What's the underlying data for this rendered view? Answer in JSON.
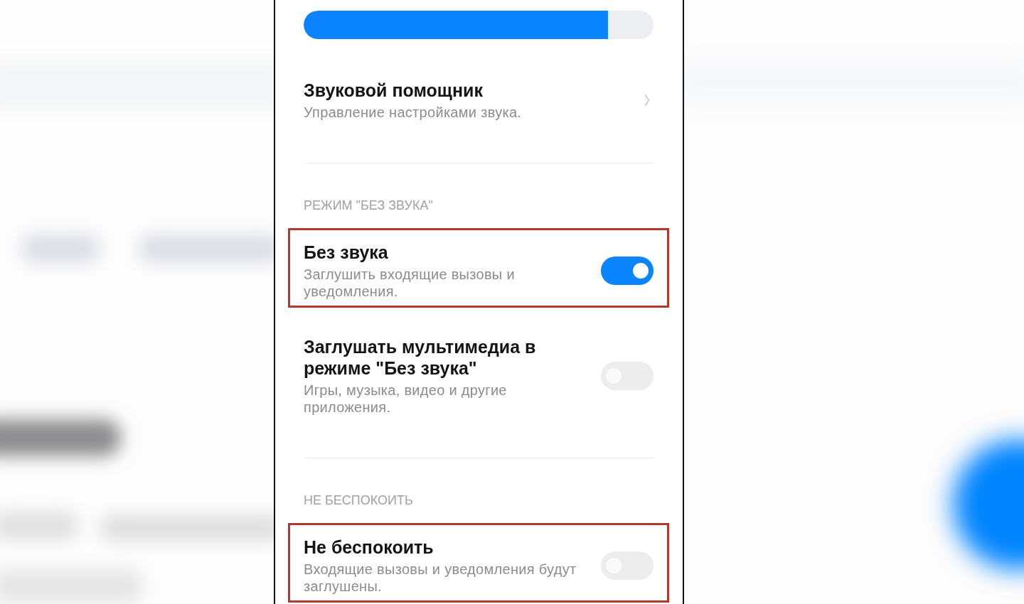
{
  "volume_slider": {
    "level": 0.87
  },
  "sections": [
    {
      "items": [
        {
          "kind": "link",
          "title": "Звуковой помощник",
          "subtitle": "Управление настройками звука.",
          "highlighted": false
        }
      ]
    },
    {
      "header": "РЕЖИМ \"БЕЗ ЗВУКА\"",
      "items": [
        {
          "kind": "toggle",
          "title": "Без звука",
          "subtitle": "Заглушить входящие вызовы и уведомления.",
          "on": true,
          "highlighted": true
        },
        {
          "kind": "toggle",
          "title": "Заглушать мультимедиа в режиме \"Без звука\"",
          "subtitle": "Игры, музыка, видео и другие приложения.",
          "on": false,
          "highlighted": false
        }
      ]
    },
    {
      "header": "НЕ БЕСПОКОИТЬ",
      "items": [
        {
          "kind": "toggle",
          "title": "Не беспокоить",
          "subtitle": "Входящие вызовы и уведомления будут заглушены.",
          "on": false,
          "highlighted": true
        }
      ]
    }
  ]
}
